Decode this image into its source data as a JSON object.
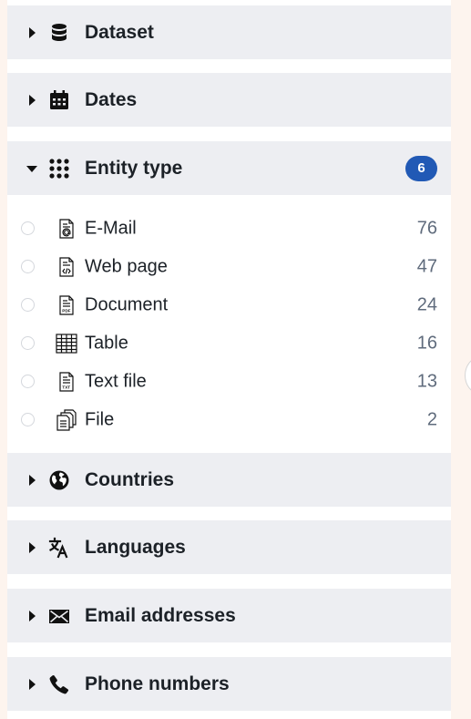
{
  "sections": {
    "dataset": {
      "title": "Dataset",
      "icon": "database-icon",
      "expanded": false
    },
    "dates": {
      "title": "Dates",
      "icon": "calendar-icon",
      "expanded": false
    },
    "entity_type": {
      "title": "Entity type",
      "icon": "grid-dots-icon",
      "expanded": true,
      "badge": "6",
      "options": [
        {
          "label": "E-Mail",
          "count": "76",
          "icon": "email-document-icon"
        },
        {
          "label": "Web page",
          "count": "47",
          "icon": "code-document-icon"
        },
        {
          "label": "Document",
          "count": "24",
          "icon": "pdf-document-icon"
        },
        {
          "label": "Table",
          "count": "16",
          "icon": "table-icon"
        },
        {
          "label": "Text file",
          "count": "13",
          "icon": "txt-document-icon"
        },
        {
          "label": "File",
          "count": "2",
          "icon": "documents-stack-icon"
        }
      ]
    },
    "countries": {
      "title": "Countries",
      "icon": "globe-icon",
      "expanded": false
    },
    "languages": {
      "title": "Languages",
      "icon": "translate-icon",
      "expanded": false
    },
    "email_addresses": {
      "title": "Email addresses",
      "icon": "envelope-icon",
      "expanded": false
    },
    "phone_numbers": {
      "title": "Phone numbers",
      "icon": "phone-icon",
      "expanded": false
    }
  },
  "colors": {
    "page_background": "#fdf4ee",
    "header_background": "#edeef2",
    "badge": "#2159b5",
    "count_text": "#5f6b7c"
  }
}
